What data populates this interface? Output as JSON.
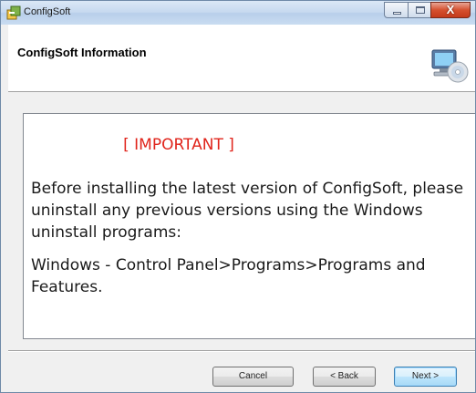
{
  "window": {
    "title": "ConfigSoft",
    "app_icon": "installer-box-icon",
    "controls": {
      "minimize_icon": "minimize-icon",
      "maximize_icon": "maximize-icon",
      "close_glyph": "X"
    }
  },
  "header": {
    "title": "ConfigSoft Information",
    "icon": "computer-cd-icon"
  },
  "content": {
    "important": "[ IMPORTANT ]",
    "paragraph1": "Before installing the latest version of ConfigSoft, please uninstall any previous versions using the Windows uninstall programs:",
    "paragraph2": "Windows - Control Panel>Programs>Programs and Features."
  },
  "buttons": {
    "cancel": "Cancel",
    "back": "< Back",
    "next": "Next >"
  },
  "colors": {
    "important_text": "#e0241b",
    "close_button": "#c43a1b",
    "titlebar": "#c6d9ef"
  }
}
